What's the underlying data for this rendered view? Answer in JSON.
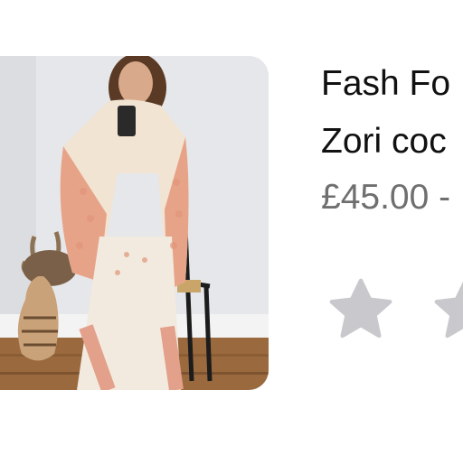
{
  "product": {
    "brand": "Fash Fo",
    "name": "Zori coc",
    "price": "£45.00 -",
    "rating_stars_visible": 2,
    "rating_value": 0
  },
  "colors": {
    "title": "#111111",
    "price": "#6f6f6f",
    "star_empty": "#c9c9cd",
    "image_wall": "#e9eaec",
    "floor": "#9a6a3e"
  },
  "icons": {
    "star": "star-outline-icon"
  }
}
